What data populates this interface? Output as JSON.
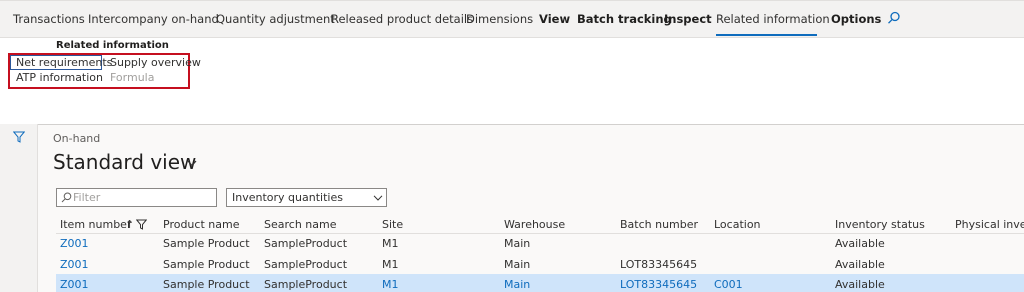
{
  "tabs": [
    {
      "label": "Transactions",
      "bold": false
    },
    {
      "label": "Intercompany on-hand",
      "bold": false
    },
    {
      "label": "Quantity adjustment",
      "bold": false
    },
    {
      "label": "Released product details",
      "bold": false
    },
    {
      "label": "Dimensions",
      "bold": false
    },
    {
      "label": "View",
      "bold": true
    },
    {
      "label": "Batch tracking",
      "bold": true
    },
    {
      "label": "Inspect",
      "bold": true
    },
    {
      "label": "Related information",
      "bold": false,
      "active": true
    },
    {
      "label": "Options",
      "bold": true
    }
  ],
  "ribbon": {
    "group_title": "Related information",
    "items": {
      "net_requirements": "Net requirements",
      "supply_overview": "Supply overview",
      "atp_information": "ATP information",
      "formula": "Formula"
    }
  },
  "page": {
    "caption": "On-hand",
    "view_title": "Standard view"
  },
  "filter": {
    "placeholder": "Filter",
    "select_value": "Inventory quantities"
  },
  "grid": {
    "columns": [
      "Item number",
      "Product name",
      "Search name",
      "Site",
      "Warehouse",
      "Batch number",
      "Location",
      "Inventory status",
      "Physical invent"
    ],
    "sort_indicator": "↑",
    "rows": [
      {
        "item": "Z001",
        "product": "Sample Product",
        "search": "SampleProduct",
        "site": "M1",
        "warehouse": "Main",
        "batch": "",
        "location": "",
        "status": "Available",
        "selected": false
      },
      {
        "item": "Z001",
        "product": "Sample Product",
        "search": "SampleProduct",
        "site": "M1",
        "warehouse": "Main",
        "batch": "LOT83345645",
        "location": "",
        "status": "Available",
        "selected": false
      },
      {
        "item": "Z001",
        "product": "Sample Product",
        "search": "SampleProduct",
        "site": "M1",
        "warehouse": "Main",
        "batch": "LOT83345645",
        "location": "C001",
        "status": "Available",
        "selected": true
      }
    ]
  },
  "colors": {
    "accent": "#0f6cbd",
    "highlight_box": "#c50f1f",
    "selected_row": "#cfe4fa"
  },
  "icons": [
    "search-icon",
    "filter-funnel-icon",
    "chevron-down-icon",
    "sort-ascending-icon"
  ]
}
